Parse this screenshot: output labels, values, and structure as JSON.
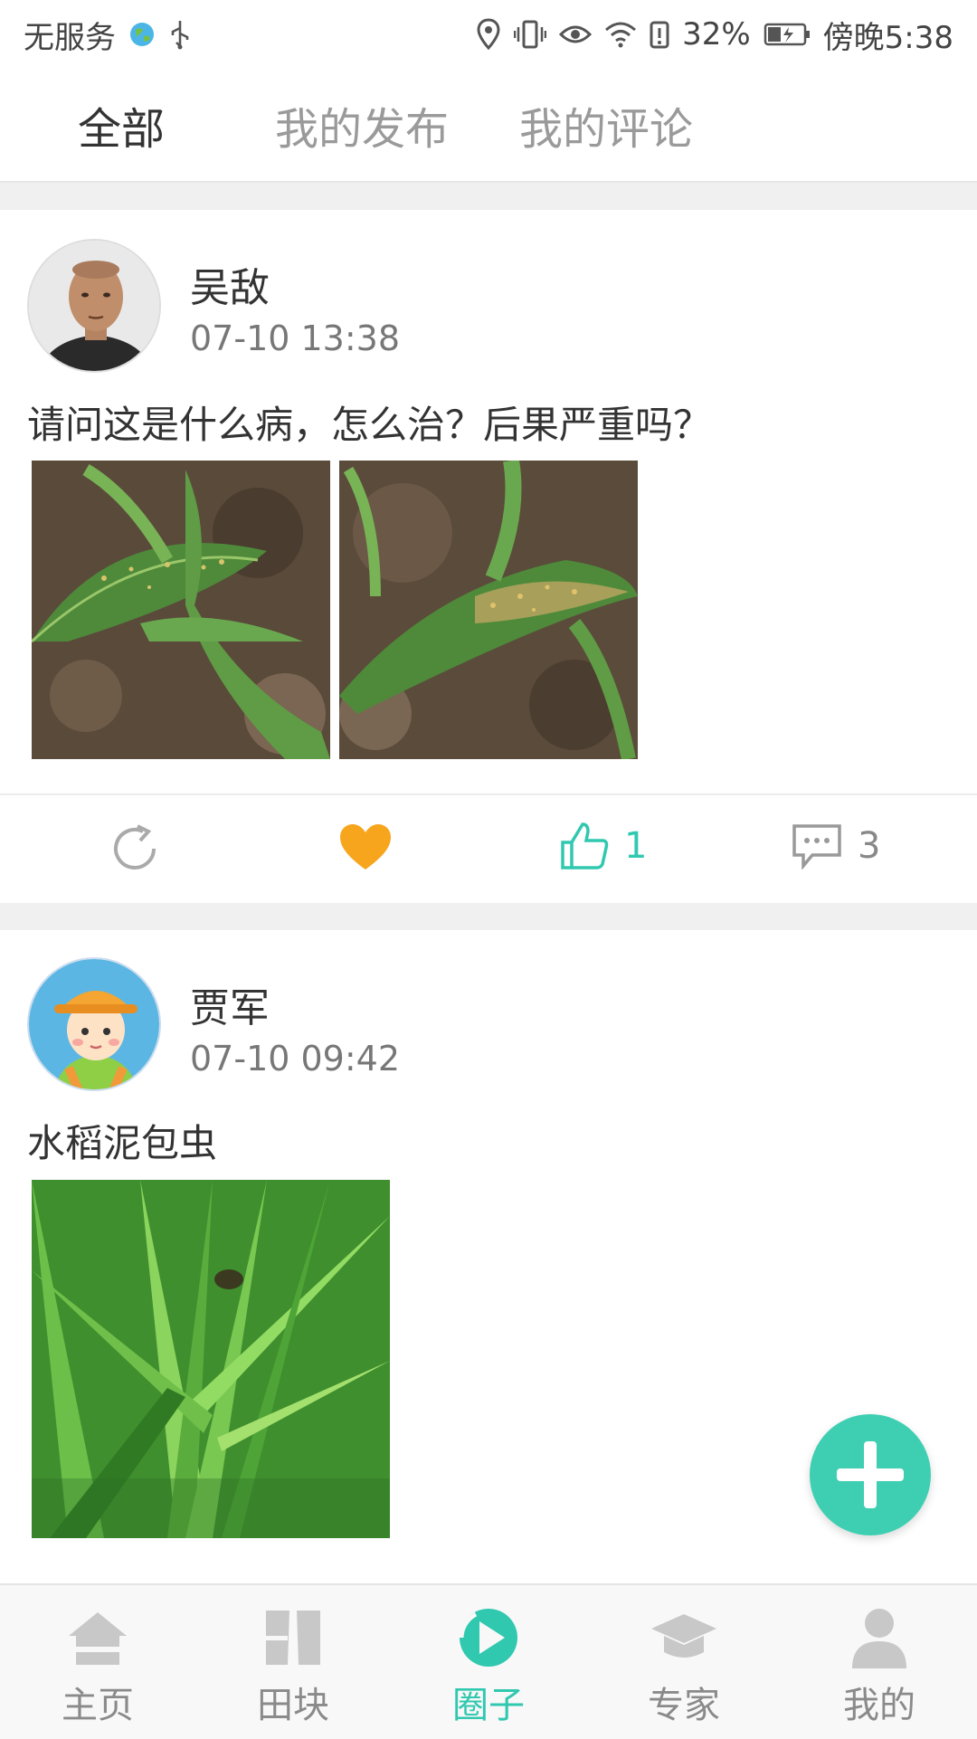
{
  "status_bar": {
    "carrier": "无服务",
    "battery": "32%",
    "time": "傍晚5:38"
  },
  "tabs": [
    {
      "label": "全部",
      "active": true
    },
    {
      "label": "我的发布",
      "active": false
    },
    {
      "label": "我的评论",
      "active": false
    }
  ],
  "posts": [
    {
      "user": "吴敌",
      "time": "07-10 13:38",
      "text": "请问这是什么病，怎么治？后果严重吗？",
      "image_count": 2,
      "likes": "1",
      "comments": "3"
    },
    {
      "user": "贾军",
      "time": "07-10 09:42",
      "text": "水稻泥包虫",
      "image_count": 1
    }
  ],
  "bottom_nav": [
    {
      "label": "主页",
      "icon": "home-icon"
    },
    {
      "label": "田块",
      "icon": "field-icon"
    },
    {
      "label": "圈子",
      "icon": "circle-icon",
      "active": true
    },
    {
      "label": "专家",
      "icon": "expert-icon"
    },
    {
      "label": "我的",
      "icon": "profile-icon"
    }
  ],
  "colors": {
    "accent": "#31c8b0",
    "heart": "#f7a51c",
    "fab": "#3ecfb2"
  }
}
